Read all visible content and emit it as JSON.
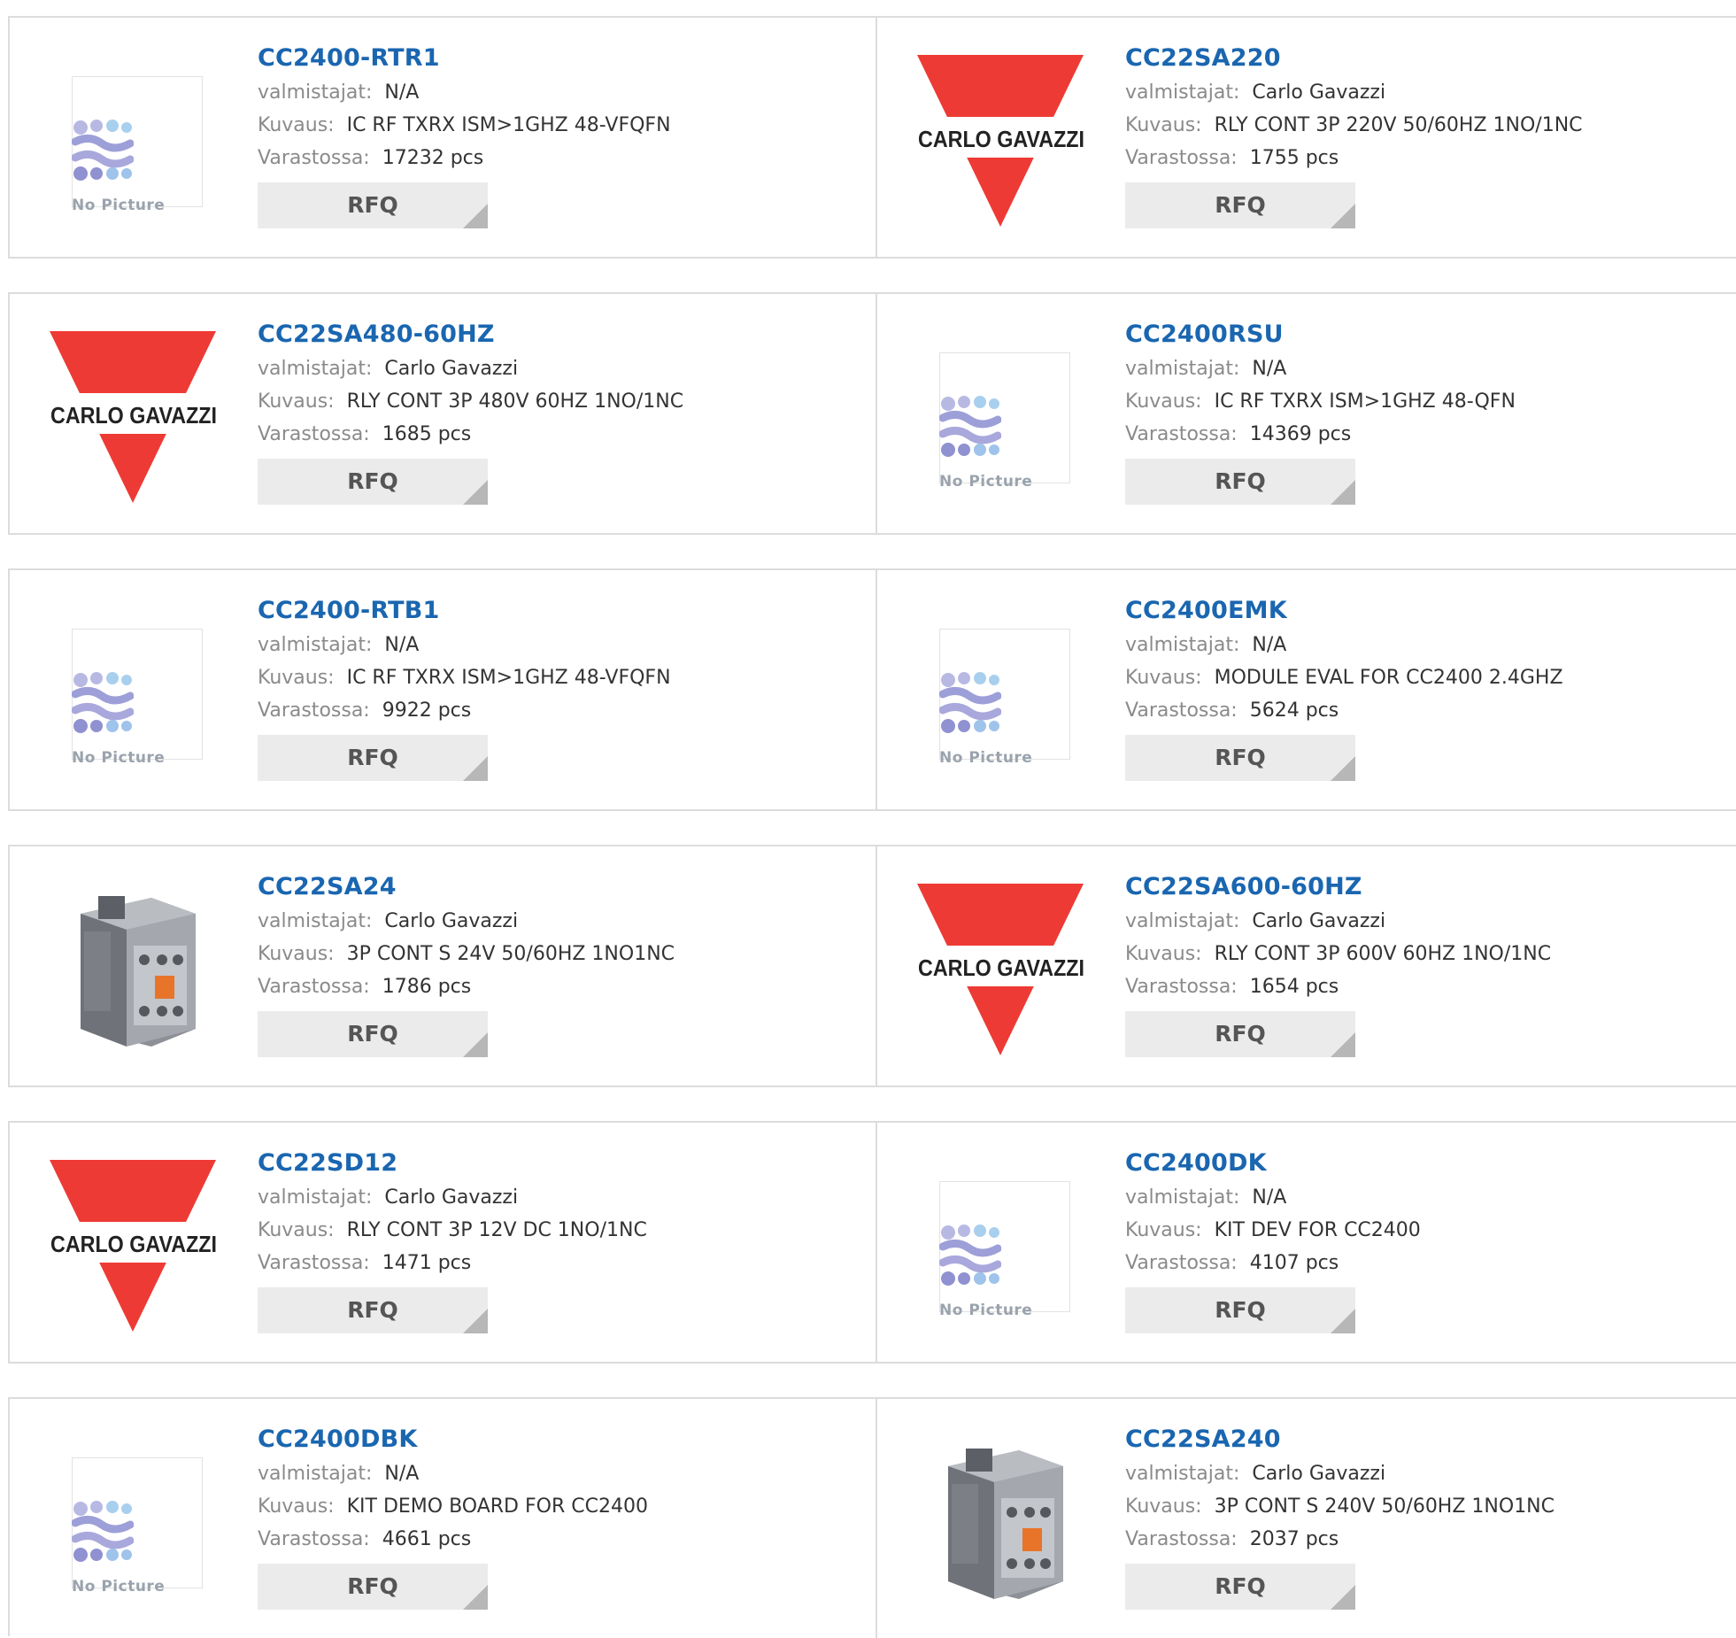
{
  "labels": {
    "manufacturer": "valmistajat:",
    "description": "Kuvaus:",
    "stock": "Varastossa:",
    "rfq": "RFQ",
    "no_picture": "No Picture",
    "brand_logo_text": "CARLO GAVAZZI"
  },
  "colors": {
    "part_link": "#1a66b0",
    "logo_red": "#ee3a34",
    "rfq_bg": "#ebebeb"
  },
  "rows": [
    [
      {
        "part": "CC2400-RTR1",
        "manufacturer": "N/A",
        "description": "IC RF TXRX ISM>1GHZ 48-VFQFN",
        "stock": "17232 pcs",
        "image": "no-picture"
      },
      {
        "part": "CC22SA220",
        "manufacturer": "Carlo Gavazzi",
        "description": "RLY CONT 3P 220V 50/60HZ 1NO/1NC",
        "stock": "1755 pcs",
        "image": "carlo-gavazzi-logo"
      }
    ],
    [
      {
        "part": "CC22SA480-60HZ",
        "manufacturer": "Carlo Gavazzi",
        "description": "RLY CONT 3P 480V 60HZ 1NO/1NC",
        "stock": "1685 pcs",
        "image": "carlo-gavazzi-logo"
      },
      {
        "part": "CC2400RSU",
        "manufacturer": "N/A",
        "description": "IC RF TXRX ISM>1GHZ 48-QFN",
        "stock": "14369 pcs",
        "image": "no-picture"
      }
    ],
    [
      {
        "part": "CC2400-RTB1",
        "manufacturer": "N/A",
        "description": "IC RF TXRX ISM>1GHZ 48-VFQFN",
        "stock": "9922 pcs",
        "image": "no-picture"
      },
      {
        "part": "CC2400EMK",
        "manufacturer": "N/A",
        "description": "MODULE EVAL FOR CC2400 2.4GHZ",
        "stock": "5624 pcs",
        "image": "no-picture"
      }
    ],
    [
      {
        "part": "CC22SA24",
        "manufacturer": "Carlo Gavazzi",
        "description": "3P CONT S 24V 50/60HZ 1NO1NC",
        "stock": "1786 pcs",
        "image": "contactor-photo"
      },
      {
        "part": "CC22SA600-60HZ",
        "manufacturer": "Carlo Gavazzi",
        "description": "RLY CONT 3P 600V 60HZ 1NO/1NC",
        "stock": "1654 pcs",
        "image": "carlo-gavazzi-logo"
      }
    ],
    [
      {
        "part": "CC22SD12",
        "manufacturer": "Carlo Gavazzi",
        "description": "RLY CONT 3P 12V DC 1NO/1NC",
        "stock": "1471 pcs",
        "image": "carlo-gavazzi-logo"
      },
      {
        "part": "CC2400DK",
        "manufacturer": "N/A",
        "description": "KIT DEV FOR CC2400",
        "stock": "4107 pcs",
        "image": "no-picture"
      }
    ],
    [
      {
        "part": "CC2400DBK",
        "manufacturer": "N/A",
        "description": "KIT DEMO BOARD FOR CC2400",
        "stock": "4661 pcs",
        "image": "no-picture"
      },
      {
        "part": "CC22SA240",
        "manufacturer": "Carlo Gavazzi",
        "description": "3P CONT S 240V 50/60HZ 1NO1NC",
        "stock": "2037 pcs",
        "image": "contactor-photo"
      }
    ]
  ]
}
